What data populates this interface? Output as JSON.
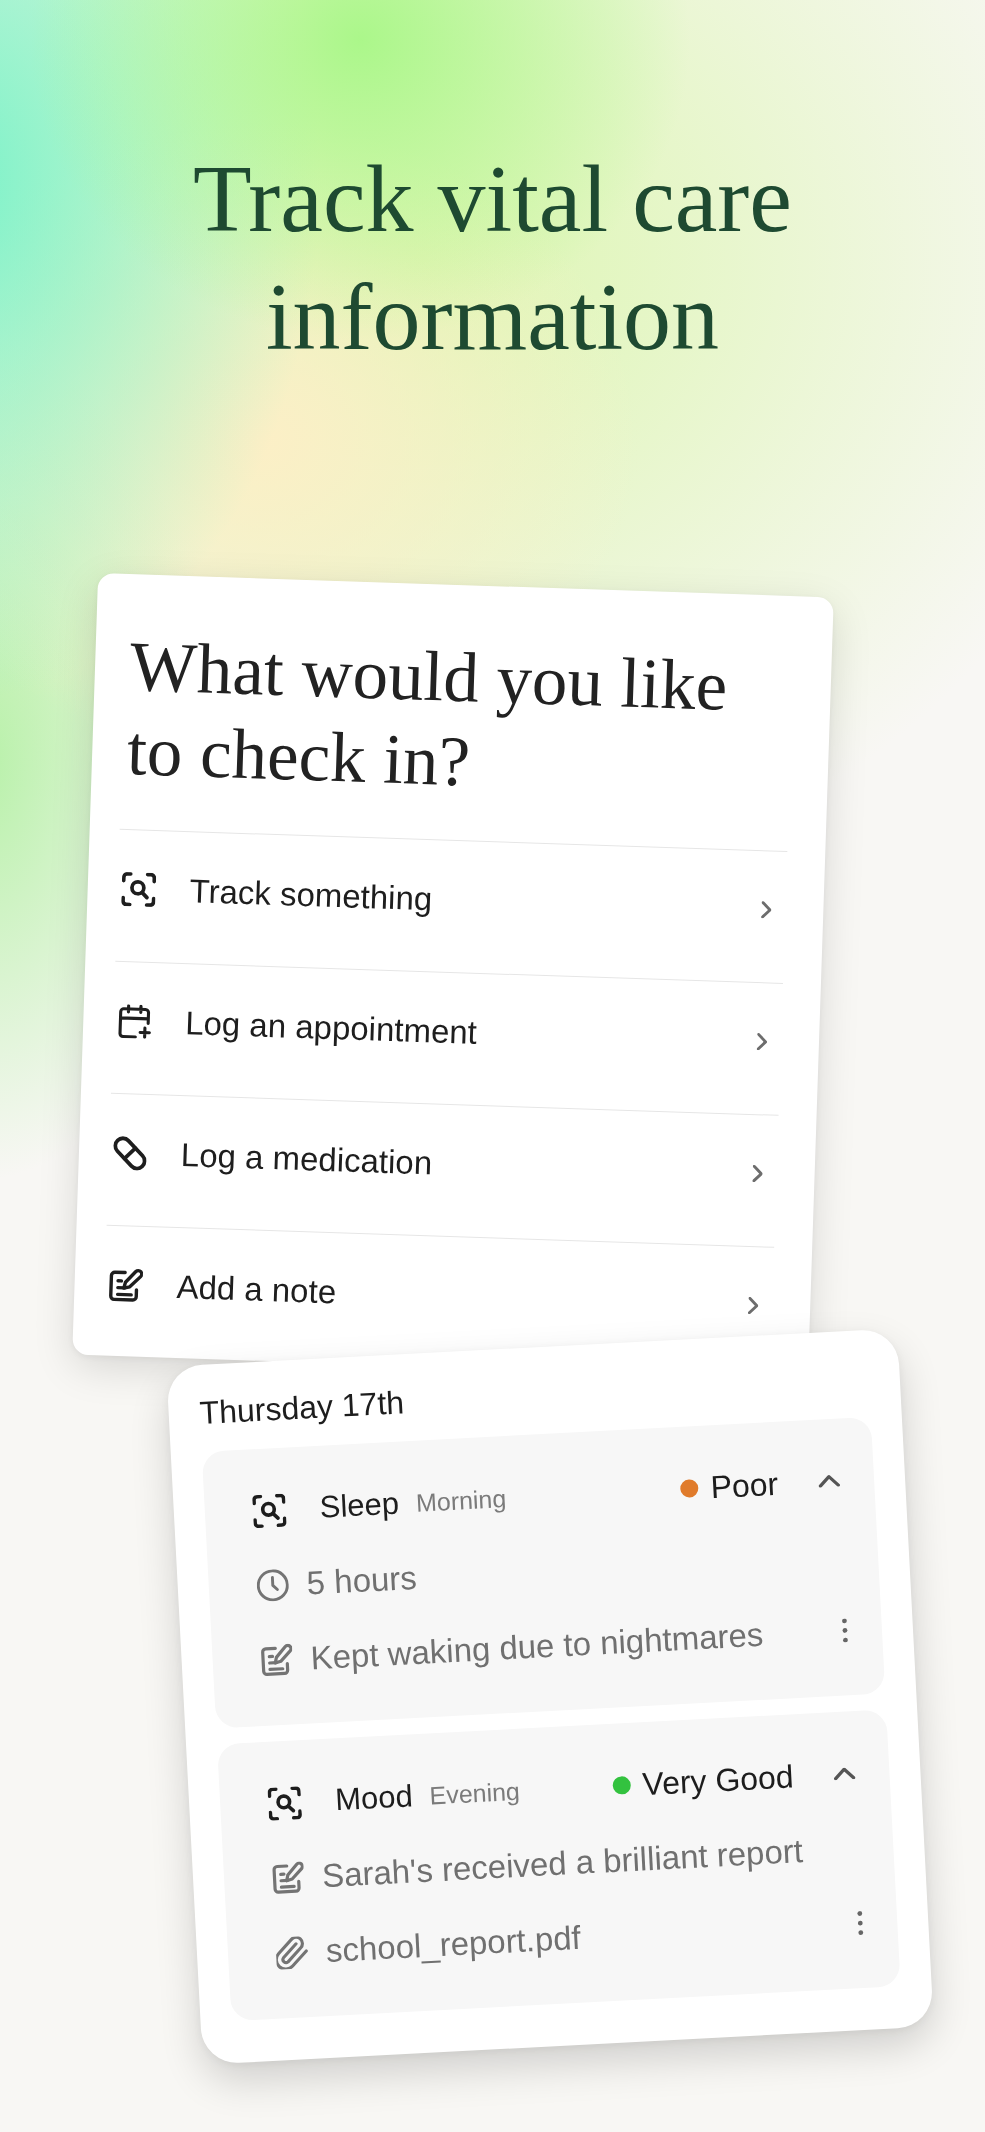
{
  "headline": "Track vital care information",
  "check_in_card": {
    "title": "What would you like to check in?",
    "options": [
      {
        "kind": "track",
        "label": "Track something"
      },
      {
        "kind": "appointment",
        "label": "Log an appointment"
      },
      {
        "kind": "medication",
        "label": "Log a medication"
      },
      {
        "kind": "note",
        "label": "Add a note"
      }
    ]
  },
  "log_card": {
    "date": "Thursday 17th",
    "entries": [
      {
        "category": "Sleep",
        "time_of_day": "Morning",
        "rating": "Poor",
        "color": "#e07b2b",
        "expanded": true,
        "details": [
          {
            "kind": "duration",
            "text": "5 hours"
          },
          {
            "kind": "note",
            "text": "Kept waking due to nightmares"
          }
        ]
      },
      {
        "category": "Mood",
        "time_of_day": "Evening",
        "rating": "Very Good",
        "color": "#33c23f",
        "expanded": true,
        "details": [
          {
            "kind": "note",
            "text": "Sarah's received a brilliant report"
          },
          {
            "kind": "attachment",
            "text": "school_report.pdf"
          }
        ]
      }
    ]
  }
}
